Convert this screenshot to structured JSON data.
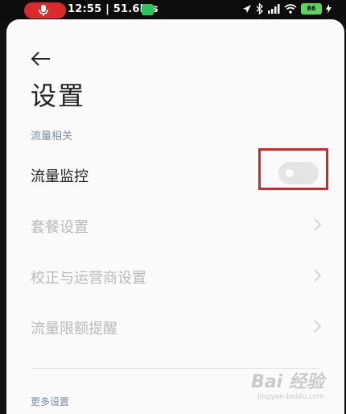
{
  "status_bar": {
    "time": "12:55",
    "speed": "51.6K/s",
    "battery": "86"
  },
  "page": {
    "title": "设置",
    "section_header": "流量相关",
    "items": [
      {
        "label": "流量监控",
        "type": "toggle",
        "enabled": true,
        "toggle_on": false
      },
      {
        "label": "套餐设置",
        "type": "link",
        "enabled": false
      },
      {
        "label": "校正与运营商设置",
        "type": "link",
        "enabled": false
      },
      {
        "label": "流量限额提醒",
        "type": "link",
        "enabled": false
      }
    ],
    "section2_header": "更多设置"
  },
  "watermark": {
    "main": "Bai 经验",
    "sub": "jingyan.baidu.com"
  },
  "colors": {
    "highlight": "#d8232a",
    "record_pill": "#d92b2b",
    "section_header": "#7b8fa6"
  }
}
